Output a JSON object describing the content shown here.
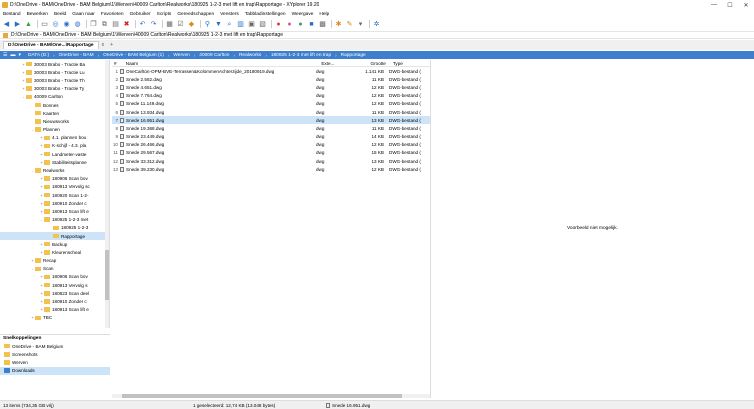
{
  "window": {
    "title": "D:\\OneDrive - BAM\\OneDrive - BAM Belgium\\1\\Werven\\40009 Carlton\\Realworks\\180925 1-2-3 met lift en trap\\Rapportage - XYplorer 19.20",
    "min": "—",
    "max": "☐",
    "close": "✕"
  },
  "menu": [
    "Bestand",
    "Bewerken",
    "Beeld",
    "Gaan naar",
    "Favorieten",
    "Gebruiker",
    "Scripts",
    "Gereedschappen",
    "Vensters",
    "Tabbladinstellingen",
    "Weergave",
    "Help"
  ],
  "address": "D:\\OneDrive - BAM\\OneDrive - BAM Belgium\\1\\Werven\\40009 Carlton\\Realworks\\180925 1-2-3 met lift en trap\\Rapportage",
  "tab": {
    "label": "D:\\OneDrive - BAM\\One...\\Rapportage",
    "close": "x",
    "add": "+"
  },
  "breadcrumb": [
    "DATA (D:)",
    "OneDrive - BAM",
    "OneDrive - BAM Belgium (1)",
    "Werven",
    "40009 Carlton",
    "Realworks",
    "180925 1-2-3 met lift en trap",
    "Rapportage"
  ],
  "tree": [
    {
      "label": "30003 Brabo - Tractie Ba",
      "level": 3,
      "exp": "+"
    },
    {
      "label": "30003 Brabo - Tractie Lu",
      "level": 3,
      "exp": "+"
    },
    {
      "label": "30003 Brabo - Tractie Th",
      "level": 3,
      "exp": "+"
    },
    {
      "label": "30003 Brabo - Tractie Ty",
      "level": 3,
      "exp": "+"
    },
    {
      "label": "40009 Carlton",
      "level": 3,
      "exp": "-"
    },
    {
      "label": "Bonnes",
      "level": 4,
      "exp": ""
    },
    {
      "label": "Kaarten",
      "level": 4,
      "exp": ""
    },
    {
      "label": "Nieuwsvorks",
      "level": 4,
      "exp": ""
    },
    {
      "label": "Plannen",
      "level": 4,
      "exp": "-"
    },
    {
      "label": "4.1. plannen bou",
      "level": 5,
      "exp": "+"
    },
    {
      "label": "K-schijf - 4.3. pla",
      "level": 5,
      "exp": "+"
    },
    {
      "label": "Landmeter-vaste",
      "level": 5,
      "exp": "+"
    },
    {
      "label": "Stabiliteitsplanne",
      "level": 5,
      "exp": "+"
    },
    {
      "label": "Realworks",
      "level": 4,
      "exp": "-"
    },
    {
      "label": "180906 Scan bov",
      "level": 5,
      "exp": "+"
    },
    {
      "label": "180913 Vervolg sc",
      "level": 5,
      "exp": "+"
    },
    {
      "label": "180920 Scan 1-2-",
      "level": 5,
      "exp": "+"
    },
    {
      "label": "180910 Zonder c",
      "level": 5,
      "exp": "+"
    },
    {
      "label": "180913 Scan lift e",
      "level": 5,
      "exp": "+"
    },
    {
      "label": "180925 1-2-3 met",
      "level": 5,
      "exp": "-"
    },
    {
      "label": "180925 1-2-3",
      "level": 6,
      "exp": ""
    },
    {
      "label": "Rapportage",
      "level": 6,
      "exp": "",
      "selected": true
    },
    {
      "label": "Backup",
      "level": 5,
      "exp": "+"
    },
    {
      "label": "Kleurenscheal",
      "level": 5,
      "exp": "+"
    },
    {
      "label": "Recap",
      "level": 4,
      "exp": "+"
    },
    {
      "label": "Scan",
      "level": 4,
      "exp": "-"
    },
    {
      "label": "180906 Scan bov",
      "level": 5,
      "exp": "+"
    },
    {
      "label": "180913 Vervolg s",
      "level": 5,
      "exp": "+"
    },
    {
      "label": "180823 Scan deel",
      "level": 5,
      "exp": "+"
    },
    {
      "label": "180910 Zonder c",
      "level": 5,
      "exp": "+"
    },
    {
      "label": "180913 Scan lift e",
      "level": 5,
      "exp": "+"
    },
    {
      "label": "TBC",
      "level": 4,
      "exp": "+"
    }
  ],
  "favorites": {
    "header": "Snelkoppelingen",
    "items": [
      {
        "label": "OneDrive - BAM Belgium"
      },
      {
        "label": "Screenshots"
      },
      {
        "label": "Werven"
      },
      {
        "label": "Downloads",
        "selected": true
      }
    ]
  },
  "filelist": {
    "columns": [
      "#",
      "Naam",
      "Exte...",
      "Grootte",
      "Type"
    ],
    "rows": [
      {
        "idx": "1",
        "name": "OneCarlton-OPM-BVE-Terrassen&KolommenAchterzijde_20180919.dwg",
        "ext": "dwg",
        "size": "1.141 KB",
        "type": "DWG-bestand ("
      },
      {
        "idx": "2",
        "name": "Snede 2.562.dwg",
        "ext": "dwg",
        "size": "11 KB",
        "type": "DWG-bestand ("
      },
      {
        "idx": "3",
        "name": "Snede 4.651.dwg",
        "ext": "dwg",
        "size": "12 KB",
        "type": "DWG-bestand ("
      },
      {
        "idx": "4",
        "name": "Snede 7.764.dwg",
        "ext": "dwg",
        "size": "12 KB",
        "type": "DWG-bestand ("
      },
      {
        "idx": "5",
        "name": "Snede 11.149.dwg",
        "ext": "dwg",
        "size": "12 KB",
        "type": "DWG-bestand ("
      },
      {
        "idx": "6",
        "name": "Snede 13.934.dwg",
        "ext": "dwg",
        "size": "11 KB",
        "type": "DWG-bestand ("
      },
      {
        "idx": "7",
        "name": "Snede 16.951.dwg",
        "ext": "dwg",
        "size": "13 KB",
        "type": "DWG-bestand (",
        "selected": true
      },
      {
        "idx": "8",
        "name": "Snede 19.368.dwg",
        "ext": "dwg",
        "size": "11 KB",
        "type": "DWG-bestand ("
      },
      {
        "idx": "9",
        "name": "Snede 23.449.dwg",
        "ext": "dwg",
        "size": "14 KB",
        "type": "DWG-bestand ("
      },
      {
        "idx": "10",
        "name": "Snede 26.466.dwg",
        "ext": "dwg",
        "size": "12 KB",
        "type": "DWG-bestand ("
      },
      {
        "idx": "11",
        "name": "Snede 29.567.dwg",
        "ext": "dwg",
        "size": "15 KB",
        "type": "DWG-bestand ("
      },
      {
        "idx": "12",
        "name": "Snede 33.312.dwg",
        "ext": "dwg",
        "size": "13 KB",
        "type": "DWG-bestand ("
      },
      {
        "idx": "13",
        "name": "Snede 39.230.dwg",
        "ext": "dwg",
        "size": "12 KB",
        "type": "DWG-bestand ("
      }
    ]
  },
  "preview": {
    "message": "Voorbeeld niet mogelijk."
  },
  "status": {
    "count": "13 items (734,35 GB vrij)",
    "selected": "1 geselecteerd: 12,74 KB (13.048 bytes)",
    "file": "Snede 16.951.dwg"
  },
  "colors": {
    "accent": "#3d7fcc",
    "folder": "#f2c14e",
    "selection": "#cde3f7"
  }
}
